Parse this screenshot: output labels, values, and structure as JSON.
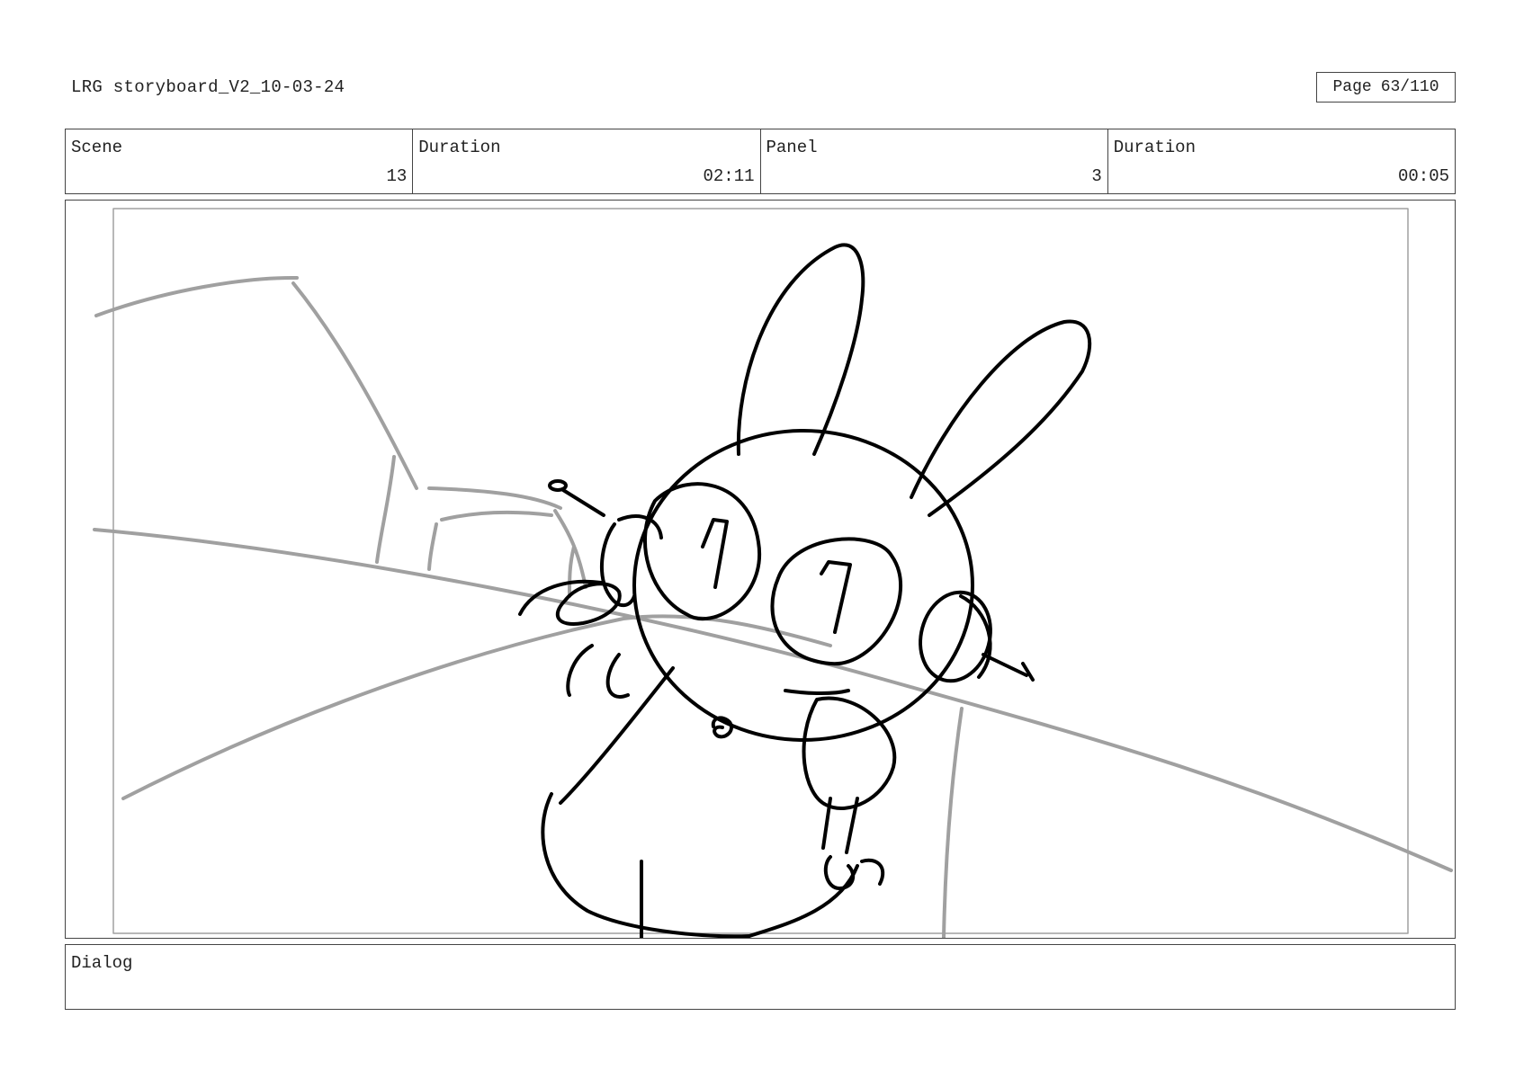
{
  "document": {
    "title": "LRG storyboard_V2_10-03-24",
    "page_label": "Page",
    "page_number": "63/110"
  },
  "info_row": {
    "scene": {
      "label": "Scene",
      "value": "13"
    },
    "scene_duration": {
      "label": "Duration",
      "value": "02:11"
    },
    "panel": {
      "label": "Panel",
      "value": "3"
    },
    "panel_duration": {
      "label": "Duration",
      "value": "00:05"
    }
  },
  "panel_image": {
    "icon": "bunny-robot-sketch",
    "line_color": "#000000",
    "guide_color": "#a0a0a0"
  },
  "dialog": {
    "label": "Dialog",
    "text": ""
  }
}
